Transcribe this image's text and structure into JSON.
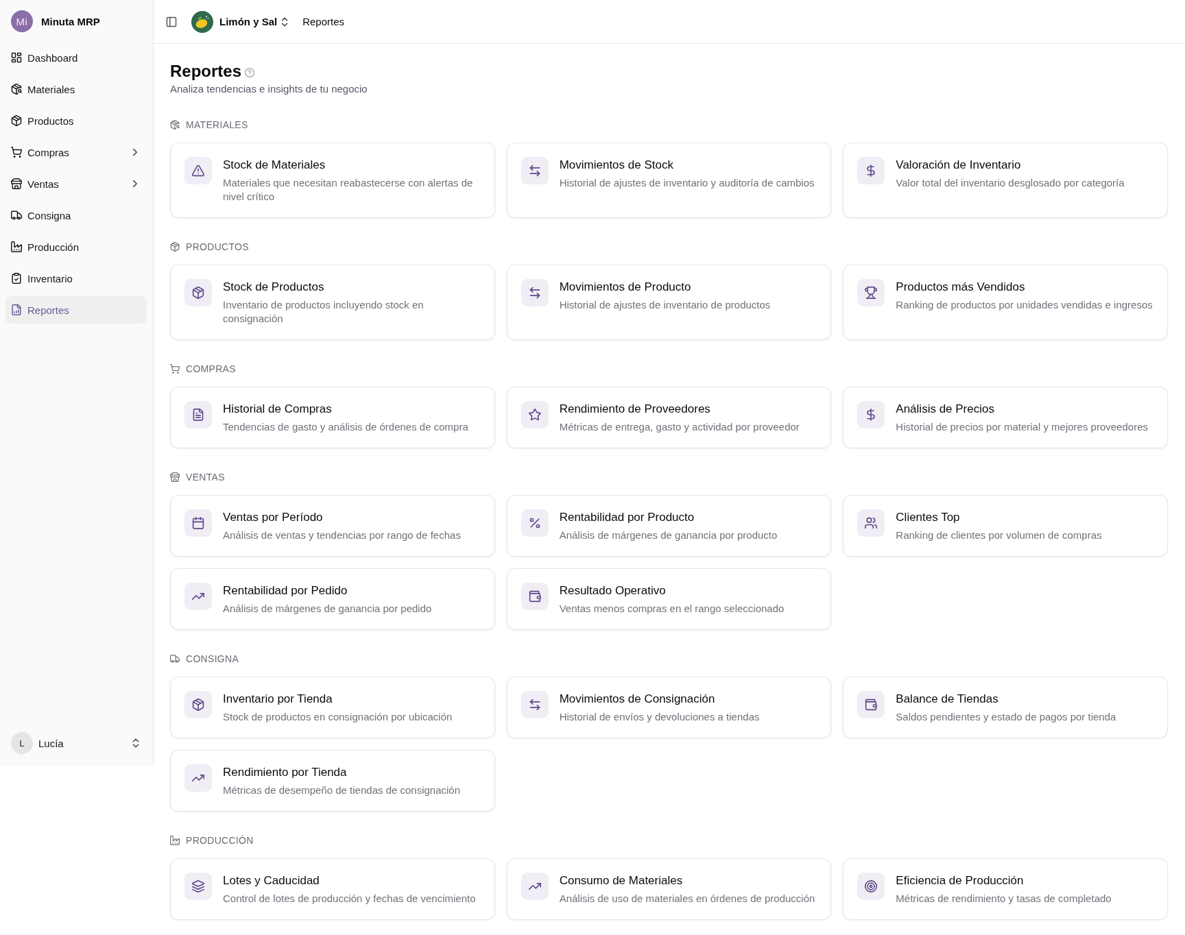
{
  "sidebar": {
    "brand": {
      "logo_text": "Mi",
      "name": "Minuta MRP"
    },
    "items": [
      {
        "label": "Dashboard",
        "kind": "link",
        "selected": false
      },
      {
        "label": "Materiales",
        "kind": "link",
        "selected": false
      },
      {
        "label": "Productos",
        "kind": "link",
        "selected": false
      },
      {
        "label": "Compras",
        "kind": "group",
        "selected": false
      },
      {
        "label": "Ventas",
        "kind": "group",
        "selected": false
      },
      {
        "label": "Consigna",
        "kind": "link",
        "selected": false
      },
      {
        "label": "Producción",
        "kind": "link",
        "selected": false
      },
      {
        "label": "Inventario",
        "kind": "link",
        "selected": false
      },
      {
        "label": "Reportes",
        "kind": "link",
        "selected": true
      }
    ],
    "user": {
      "initial": "L",
      "name": "Lucía"
    }
  },
  "header": {
    "organization": "Limón y Sal",
    "breadcrumb": "Reportes"
  },
  "page": {
    "title": "Reportes",
    "subtitle": "Analiza tendencias e insights de tu negocio"
  },
  "sections": [
    {
      "title": "MATERIALES",
      "cards": [
        {
          "title": "Stock de Materiales",
          "description": "Materiales que necesitan reabastecerse con alertas de nivel crítico"
        },
        {
          "title": "Movimientos de Stock",
          "description": "Historial de ajustes de inventario y auditoría de cambios"
        },
        {
          "title": "Valoración de Inventario",
          "description": "Valor total del inventario desglosado por categoría"
        }
      ]
    },
    {
      "title": "PRODUCTOS",
      "cards": [
        {
          "title": "Stock de Productos",
          "description": "Inventario de productos incluyendo stock en consignación"
        },
        {
          "title": "Movimientos de Producto",
          "description": "Historial de ajustes de inventario de productos"
        },
        {
          "title": "Productos más Vendidos",
          "description": "Ranking de productos por unidades vendidas e ingresos"
        }
      ]
    },
    {
      "title": "COMPRAS",
      "cards": [
        {
          "title": "Historial de Compras",
          "description": "Tendencias de gasto y análisis de órdenes de compra"
        },
        {
          "title": "Rendimiento de Proveedores",
          "description": "Métricas de entrega, gasto y actividad por proveedor"
        },
        {
          "title": "Análisis de Precios",
          "description": "Historial de precios por material y mejores proveedores"
        }
      ]
    },
    {
      "title": "VENTAS",
      "cards": [
        {
          "title": "Ventas por Período",
          "description": "Análisis de ventas y tendencias por rango de fechas"
        },
        {
          "title": "Rentabilidad por Producto",
          "description": "Análisis de márgenes de ganancia por producto"
        },
        {
          "title": "Clientes Top",
          "description": "Ranking de clientes por volumen de compras"
        },
        {
          "title": "Rentabilidad por Pedido",
          "description": "Análisis de márgenes de ganancia por pedido"
        },
        {
          "title": "Resultado Operativo",
          "description": "Ventas menos compras en el rango seleccionado"
        }
      ]
    },
    {
      "title": "CONSIGNA",
      "cards": [
        {
          "title": "Inventario por Tienda",
          "description": "Stock de productos en consignación por ubicación"
        },
        {
          "title": "Movimientos de Consignación",
          "description": "Historial de envíos y devoluciones a tiendas"
        },
        {
          "title": "Balance de Tiendas",
          "description": "Saldos pendientes y estado de pagos por tienda"
        },
        {
          "title": "Rendimiento por Tienda",
          "description": "Métricas de desempeño de tiendas de consignación"
        }
      ]
    },
    {
      "title": "PRODUCCIÓN",
      "cards": [
        {
          "title": "Lotes y Caducidad",
          "description": "Control de lotes de producción y fechas de vencimiento"
        },
        {
          "title": "Consumo de Materiales",
          "description": "Análisis de uso de materiales en órdenes de producción"
        },
        {
          "title": "Eficiencia de Producción",
          "description": "Métricas de rendimiento y tasas de completado"
        }
      ]
    }
  ]
}
